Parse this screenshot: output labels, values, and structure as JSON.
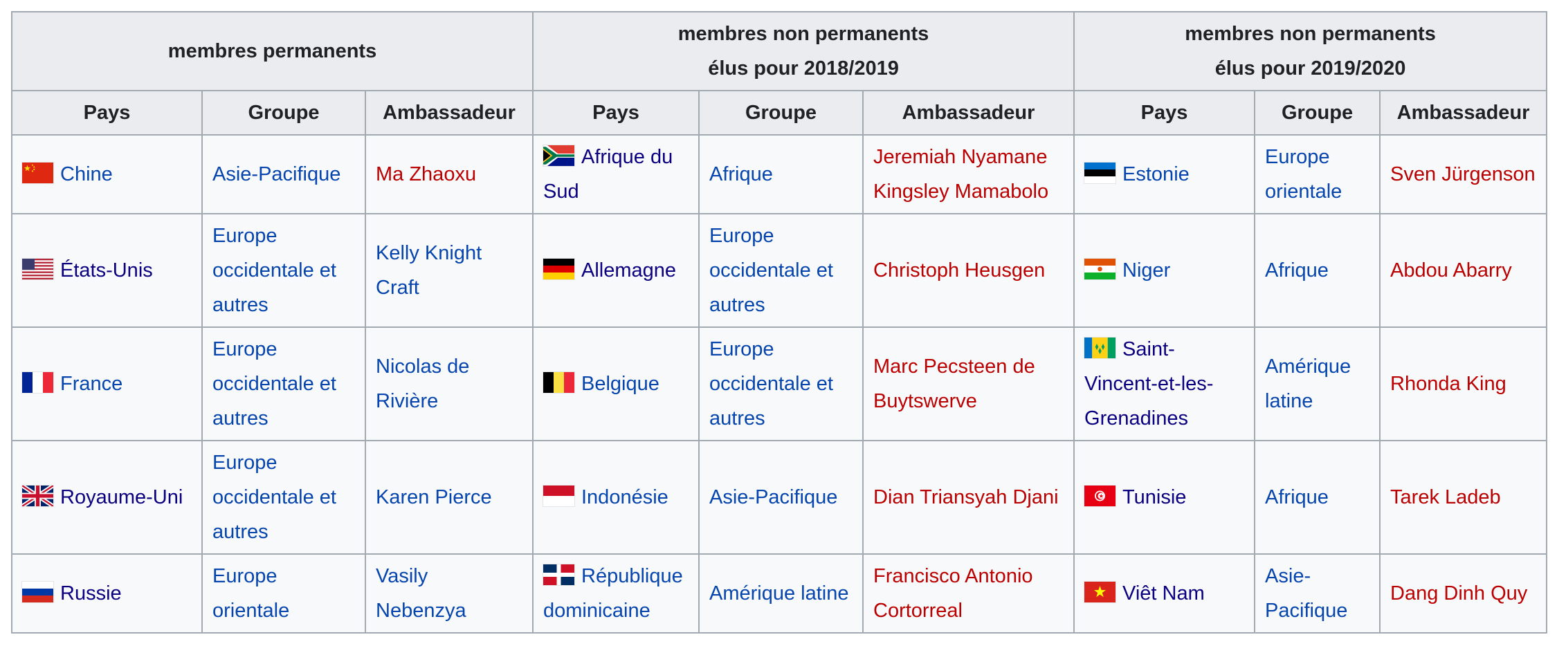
{
  "table": {
    "groups": {
      "permanent": "membres permanents",
      "np1": [
        "membres non permanents",
        "élus pour 2018/2019"
      ],
      "np2": [
        "membres non permanents",
        "élus pour 2019/2020"
      ]
    },
    "columns": [
      "Pays",
      "Groupe",
      "Ambassadeur",
      "Pays",
      "Groupe",
      "Ambassadeur",
      "Pays",
      "Groupe",
      "Ambassadeur"
    ],
    "rows": [
      [
        {
          "flag": "china-flag-icon",
          "country": "Chine",
          "group": "Asie-Pacifique",
          "ambassador": "Ma Zhaoxu",
          "ambassador_link": "new"
        },
        {
          "flag": "south-africa-flag-icon",
          "country": "Afrique du Sud",
          "group": "Afrique",
          "ambassador": "Jeremiah Nyamane Kingsley Mamabolo",
          "ambassador_link": "new"
        },
        {
          "flag": "estonia-flag-icon",
          "country": "Estonie",
          "group": "Europe orientale",
          "ambassador": "Sven Jürgenson",
          "ambassador_link": "new"
        }
      ],
      [
        {
          "flag": "usa-flag-icon",
          "country": "États-Unis",
          "group": "Europe occidentale et autres",
          "ambassador": "Kelly Knight Craft",
          "ambassador_link": "blue"
        },
        {
          "flag": "germany-flag-icon",
          "country": "Allemagne",
          "group": "Europe occidentale et autres",
          "ambassador": "Christoph Heusgen",
          "ambassador_link": "new"
        },
        {
          "flag": "niger-flag-icon",
          "country": "Niger",
          "group": "Afrique",
          "ambassador": "Abdou Abarry",
          "ambassador_link": "new"
        }
      ],
      [
        {
          "flag": "france-flag-icon",
          "country": "France",
          "group": "Europe occidentale et autres",
          "ambassador": "Nicolas de Rivière",
          "ambassador_link": "blue"
        },
        {
          "flag": "belgium-flag-icon",
          "country": "Belgique",
          "group": "Europe occidentale et autres",
          "ambassador": "Marc Pecsteen de Buytswerve",
          "ambassador_link": "new"
        },
        {
          "flag": "saint-vincent-flag-icon",
          "country": "Saint-Vincent-et-les-Grenadines",
          "group": "Amérique latine",
          "ambassador": "Rhonda King",
          "ambassador_link": "new"
        }
      ],
      [
        {
          "flag": "uk-flag-icon",
          "country": "Royaume-Uni",
          "group": "Europe occidentale et autres",
          "ambassador": "Karen Pierce",
          "ambassador_link": "blue"
        },
        {
          "flag": "indonesia-flag-icon",
          "country": "Indonésie",
          "group": "Asie-Pacifique",
          "ambassador": "Dian Triansyah Djani",
          "ambassador_link": "new"
        },
        {
          "flag": "tunisia-flag-icon",
          "country": "Tunisie",
          "group": "Afrique",
          "ambassador": "Tarek Ladeb",
          "ambassador_link": "new"
        }
      ],
      [
        {
          "flag": "russia-flag-icon",
          "country": "Russie",
          "group": "Europe orientale",
          "ambassador": "Vasily Nebenzya",
          "ambassador_link": "blue"
        },
        {
          "flag": "dominican-republic-flag-icon",
          "country": "République dominicaine",
          "group": "Amérique latine",
          "ambassador": "Francisco Antonio Cortorreal",
          "ambassador_link": "new"
        },
        {
          "flag": "vietnam-flag-icon",
          "country": "Viêt Nam",
          "group": "Asie-Pacifique",
          "ambassador": "Dang Dinh Quy",
          "ambassador_link": "new"
        }
      ]
    ]
  },
  "colors": {
    "link": "#0645ad",
    "new_link": "#ba0000",
    "header_bg": "#eaecf0",
    "cell_bg": "#f8f9fa",
    "border": "#a2a9b1"
  }
}
